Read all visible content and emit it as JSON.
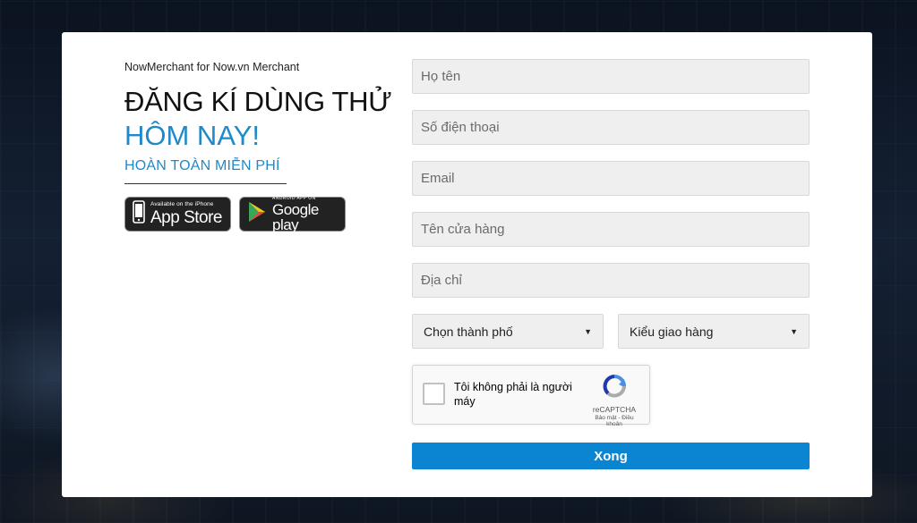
{
  "brand": "NowMerchant for Now.vn Merchant",
  "headline_line1": "ĐĂNG KÍ DÙNG THỬ",
  "headline_line2": "HÔM NAY!",
  "subheadline": "HOÀN TOÀN MIỄN PHÍ",
  "colors": {
    "accent": "#1f8ac9",
    "button": "#0b84d1",
    "field_bg": "#efefef"
  },
  "stores": {
    "apple": {
      "small": "Available on the iPhone",
      "big": "App Store",
      "icon": "iphone-icon"
    },
    "google": {
      "small": "ANDROID APP ON",
      "big": "Google play",
      "icon": "google-play-icon"
    }
  },
  "form": {
    "name_placeholder": "Họ tên",
    "phone_placeholder": "Số điện thoại",
    "email_placeholder": "Email",
    "store_placeholder": "Tên cửa hàng",
    "address_placeholder": "Địa chỉ",
    "city_select": "Chọn thành phố",
    "delivery_select": "Kiểu giao hàng",
    "captcha_label": "Tôi không phải là người máy",
    "captcha_brand": "reCAPTCHA",
    "captcha_links": "Bảo mật - Điều khoản",
    "submit_label": "Xong"
  }
}
